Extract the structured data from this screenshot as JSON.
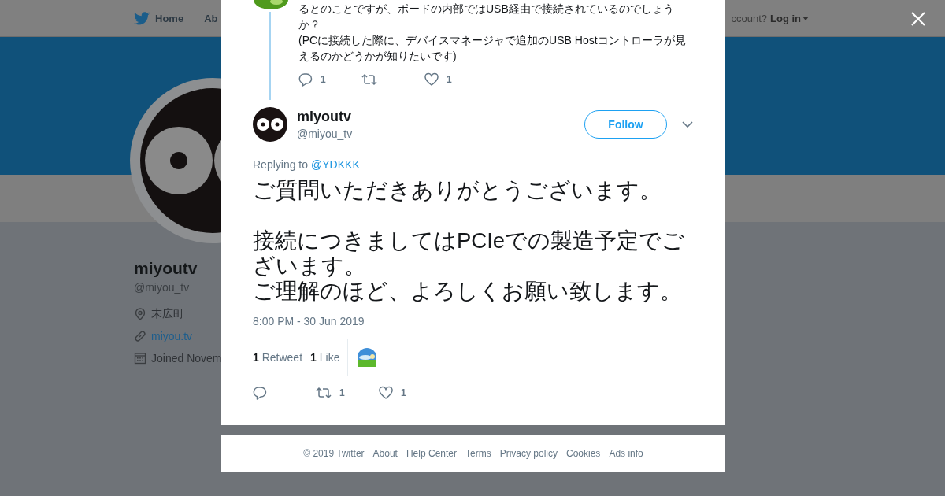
{
  "nav": {
    "items": [
      {
        "label": "Home",
        "kind": "home"
      },
      {
        "label": "Ab",
        "kind": "plain"
      }
    ],
    "account_prompt": "ccount?",
    "login": "Log in"
  },
  "profile": {
    "name": "miyoutv",
    "handle": "@miyou_tv",
    "details": [
      {
        "kind": "location",
        "text": "末広町"
      },
      {
        "kind": "link",
        "text": "miyou.tv"
      },
      {
        "kind": "joined",
        "text": "Joined Novem"
      }
    ]
  },
  "modal": {
    "parent_tweet": {
      "paragraphs": [
        "るとのことですが、ボードの内部ではUSB経由で接続されているのでしょうか？",
        "(PCに接続した際に、デバイスマネージャで追加のUSB Hostコントローラが見えるのかどうかが知りたいです)"
      ],
      "actions": [
        {
          "kind": "reply",
          "count": "1"
        },
        {
          "kind": "retweet"
        },
        {
          "kind": "like",
          "count": "1"
        }
      ]
    },
    "tweet": {
      "name": "miyoutv",
      "handle": "@miyou_tv",
      "follow": "Follow",
      "replying_label": "Replying to",
      "replying_to": "@YDKKK",
      "paragraphs": [
        "ご質問いただきありがとうございます。",
        "接続につきましてはPCIeでの製造予定でございます。",
        "ご理解のほど、よろしくお願い致します。"
      ],
      "timestamp": "8:00 PM - 30 Jun 2019",
      "stats": [
        "**1** Retweet",
        "**1** Like"
      ],
      "actions": [
        {
          "kind": "reply"
        },
        {
          "kind": "retweet",
          "count": "1"
        },
        {
          "kind": "like",
          "count": "1"
        }
      ]
    },
    "footer": [
      "© 2019 Twitter",
      "About",
      "Help Center",
      "Terms",
      "Privacy policy",
      "Cookies",
      "Ads info"
    ]
  }
}
